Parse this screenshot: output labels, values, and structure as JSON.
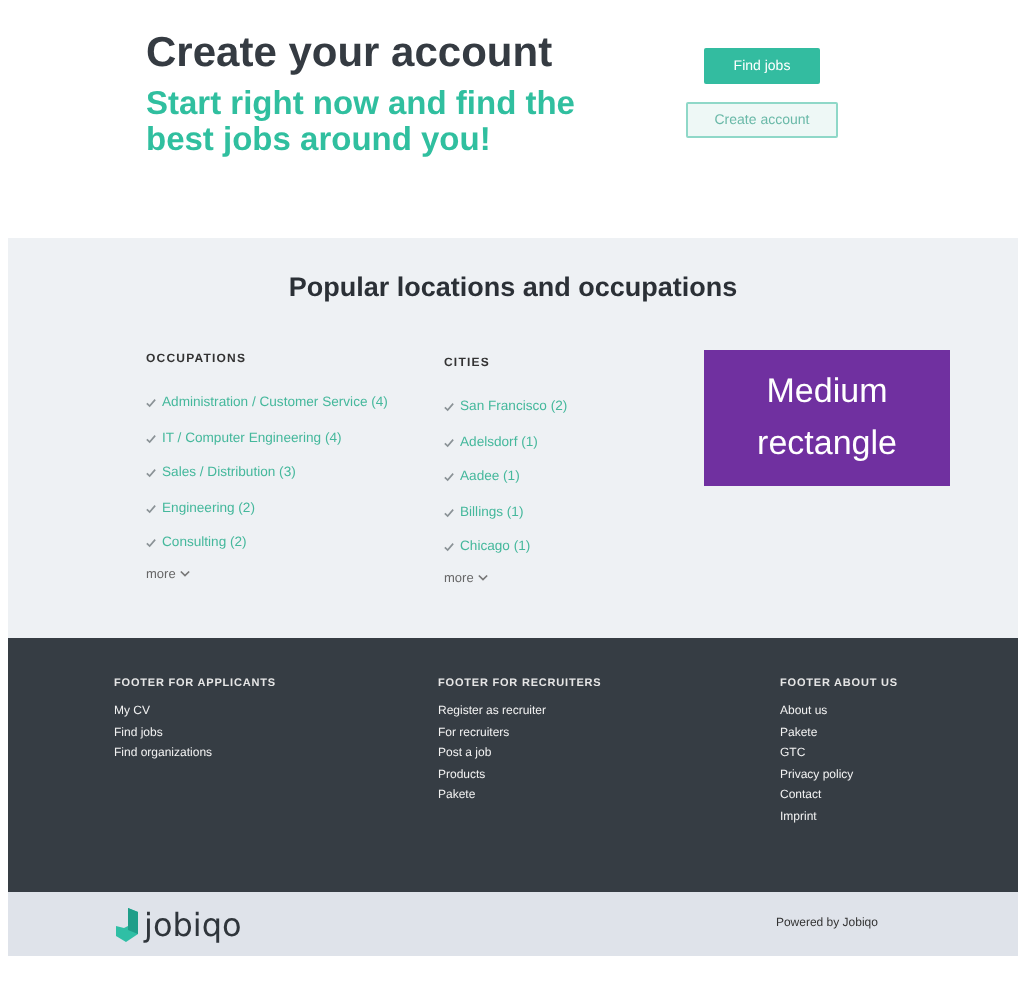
{
  "hero": {
    "title": "Create your account",
    "subtitle": "Start right now and find the best jobs around you!",
    "buttons": [
      {
        "label": "Find jobs",
        "kind": "primary"
      },
      {
        "label": "Create account",
        "kind": "outline"
      }
    ]
  },
  "popular": {
    "title": "Popular locations and occupations",
    "columns": [
      {
        "heading": "OCCUPATIONS",
        "items": [
          "Administration / Customer Service (4)",
          "IT / Computer Engineering (4)",
          "Sales / Distribution (3)",
          "Engineering (2)",
          "Consulting (2)"
        ],
        "more": "more"
      },
      {
        "heading": "CITIES",
        "items": [
          "San Francisco (2)",
          "Adelsdorf (1)",
          "Aadee (1)",
          "Billings (1)",
          "Chicago (1)"
        ],
        "more": "more"
      }
    ],
    "ad": {
      "lines": [
        "Medium",
        "rectangle"
      ]
    }
  },
  "footer": {
    "columns": [
      {
        "heading": "FOOTER FOR APPLICANTS",
        "links": [
          "My CV",
          "Find jobs",
          "Find organizations"
        ]
      },
      {
        "heading": "FOOTER FOR RECRUITERS",
        "links": [
          "Register as recruiter",
          "For recruiters",
          "Post a job",
          "Products",
          "Pakete"
        ]
      },
      {
        "heading": "FOOTER ABOUT US",
        "links": [
          "About us",
          "Pakete",
          "GTC",
          "Privacy policy",
          "Contact",
          "Imprint"
        ]
      }
    ]
  },
  "bottom_bar": {
    "logo": "jobiqo",
    "powered_by": "Powered by Jobiqo"
  }
}
